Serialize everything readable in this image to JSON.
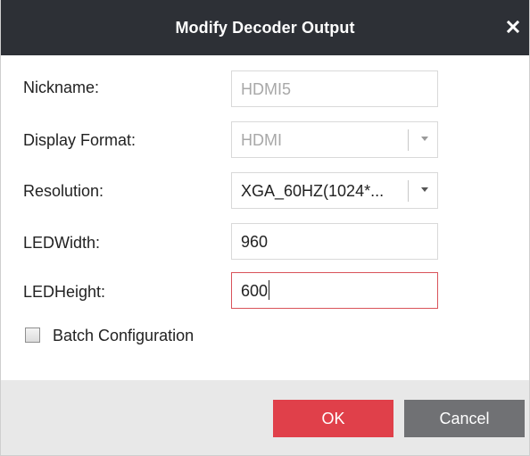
{
  "dialog": {
    "title": "Modify Decoder Output"
  },
  "form": {
    "nickname": {
      "label": "Nickname:",
      "value": "HDMI5"
    },
    "display_format": {
      "label": "Display Format:",
      "value": "HDMI"
    },
    "resolution": {
      "label": "Resolution:",
      "value": "XGA_60HZ(1024*..."
    },
    "led_width": {
      "label": "LEDWidth:",
      "value": "960"
    },
    "led_height": {
      "label": "LEDHeight:",
      "value": "600"
    },
    "batch": {
      "label": "Batch Configuration",
      "checked": false
    }
  },
  "buttons": {
    "ok": "OK",
    "cancel": "Cancel"
  },
  "colors": {
    "titlebar": "#2d3036",
    "ok": "#e0404a",
    "cancel": "#707174",
    "active_border": "#d9535a"
  },
  "icons": {
    "close": "close-icon",
    "dropdown": "chevron-down-icon"
  }
}
